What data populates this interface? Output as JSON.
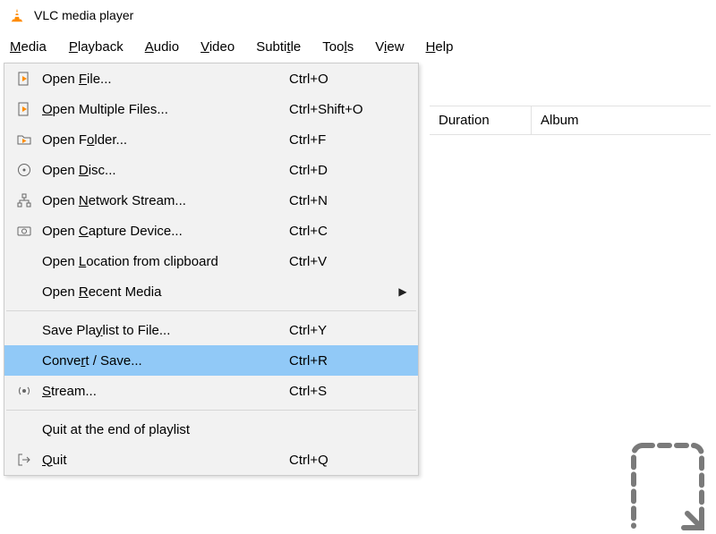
{
  "titlebar": {
    "title": "VLC media player"
  },
  "menubar": {
    "items": [
      {
        "label_pre": "",
        "mnemonic": "M",
        "label_post": "edia"
      },
      {
        "label_pre": "",
        "mnemonic": "P",
        "label_post": "layback"
      },
      {
        "label_pre": "",
        "mnemonic": "A",
        "label_post": "udio"
      },
      {
        "label_pre": "",
        "mnemonic": "V",
        "label_post": "ideo"
      },
      {
        "label_pre": "Subti",
        "mnemonic": "t",
        "label_post": "le"
      },
      {
        "label_pre": "Too",
        "mnemonic": "l",
        "label_post": "s"
      },
      {
        "label_pre": "V",
        "mnemonic": "i",
        "label_post": "ew"
      },
      {
        "label_pre": "",
        "mnemonic": "H",
        "label_post": "elp"
      }
    ]
  },
  "columns": {
    "duration": "Duration",
    "album": "Album"
  },
  "media_menu": {
    "open_file": {
      "pre": "Open ",
      "u": "F",
      "post": "ile...",
      "shortcut": "Ctrl+O"
    },
    "open_multi": {
      "pre": "",
      "u": "O",
      "post": "pen Multiple Files...",
      "shortcut": "Ctrl+Shift+O"
    },
    "open_folder": {
      "pre": "Open F",
      "u": "o",
      "post": "lder...",
      "shortcut": "Ctrl+F"
    },
    "open_disc": {
      "pre": "Open ",
      "u": "D",
      "post": "isc...",
      "shortcut": "Ctrl+D"
    },
    "open_network": {
      "pre": "Open ",
      "u": "N",
      "post": "etwork Stream...",
      "shortcut": "Ctrl+N"
    },
    "open_capture": {
      "pre": "Open ",
      "u": "C",
      "post": "apture Device...",
      "shortcut": "Ctrl+C"
    },
    "open_clipboard": {
      "pre": "Open ",
      "u": "L",
      "post": "ocation from clipboard",
      "shortcut": "Ctrl+V"
    },
    "open_recent": {
      "pre": "Open ",
      "u": "R",
      "post": "ecent Media",
      "shortcut": ""
    },
    "save_playlist": {
      "pre": "Save Pla",
      "u": "y",
      "post": "list to File...",
      "shortcut": "Ctrl+Y"
    },
    "convert_save": {
      "pre": "Conve",
      "u": "r",
      "post": "t / Save...",
      "shortcut": "Ctrl+R"
    },
    "stream": {
      "pre": "",
      "u": "S",
      "post": "tream...",
      "shortcut": "Ctrl+S"
    },
    "quit_end": {
      "pre": "Quit at the end of playlist",
      "u": "",
      "post": "",
      "shortcut": ""
    },
    "quit": {
      "pre": "",
      "u": "Q",
      "post": "uit",
      "shortcut": "Ctrl+Q"
    }
  }
}
